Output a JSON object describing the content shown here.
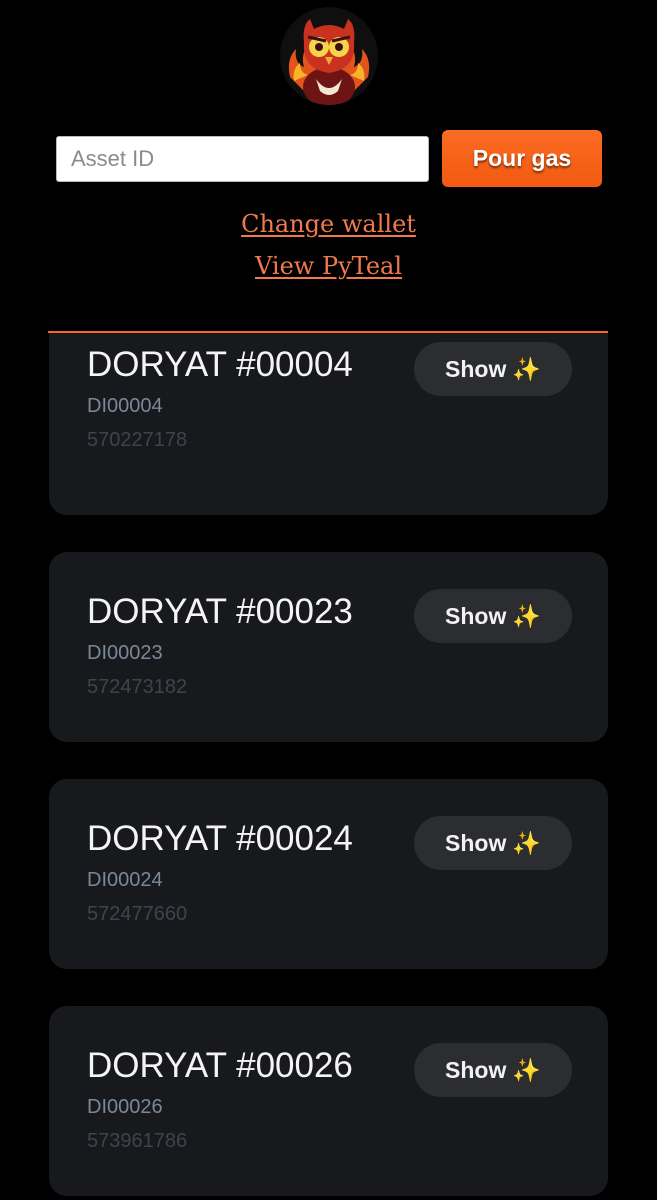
{
  "header": {
    "avatar_icon": "owl-mascot-icon"
  },
  "search": {
    "placeholder": "Asset ID",
    "value": "",
    "button_label": "Pour gas"
  },
  "links": {
    "change_wallet": "Change wallet",
    "view_pyteal": "View PyTeal"
  },
  "colors": {
    "accent": "#f2692c",
    "link": "#f07a4d",
    "card_bg": "#18191d",
    "button_bg": "#2c2d31"
  },
  "assets": [
    {
      "name": "DORYAT #00004",
      "unit": "DI00004",
      "id": "570227178",
      "action": "Show",
      "action_icon": "✨"
    },
    {
      "name": "DORYAT #00023",
      "unit": "DI00023",
      "id": "572473182",
      "action": "Show",
      "action_icon": "✨"
    },
    {
      "name": "DORYAT #00024",
      "unit": "DI00024",
      "id": "572477660",
      "action": "Show",
      "action_icon": "✨"
    },
    {
      "name": "DORYAT #00026",
      "unit": "DI00026",
      "id": "573961786",
      "action": "Show",
      "action_icon": "✨"
    }
  ]
}
